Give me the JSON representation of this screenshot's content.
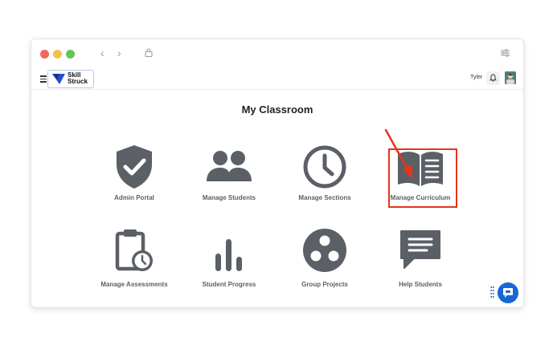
{
  "browser": {
    "controls": [
      "close",
      "minimize",
      "maximize"
    ],
    "nav": {
      "back_icon": "chevron-left-icon",
      "forward_icon": "chevron-right-icon"
    },
    "lock_icon": "lock-icon",
    "settings_icon": "sliders-icon"
  },
  "appbar": {
    "logo_line1": "Skill",
    "logo_line2": "Struck",
    "user_name": "Tyler",
    "bell_icon": "bell-icon"
  },
  "main": {
    "title": "My Classroom",
    "tiles": [
      {
        "label": "Admin Portal",
        "icon": "shield-check-icon"
      },
      {
        "label": "Manage Students",
        "icon": "users-icon"
      },
      {
        "label": "Manage Sections",
        "icon": "clock-icon"
      },
      {
        "label": "Manage Curriculum",
        "icon": "book-open-icon"
      },
      {
        "label": "Manage Assessments",
        "icon": "clipboard-clock-icon"
      },
      {
        "label": "Student Progress",
        "icon": "bar-chart-icon"
      },
      {
        "label": "Group Projects",
        "icon": "group-circles-icon"
      },
      {
        "label": "Help Students",
        "icon": "chat-message-icon"
      }
    ]
  },
  "annotation": {
    "highlighted_tile": "Manage Curriculum",
    "color": "#e8331c"
  },
  "colors": {
    "icon_gray": "#5b5f66",
    "accent_blue": "#1766d6"
  }
}
